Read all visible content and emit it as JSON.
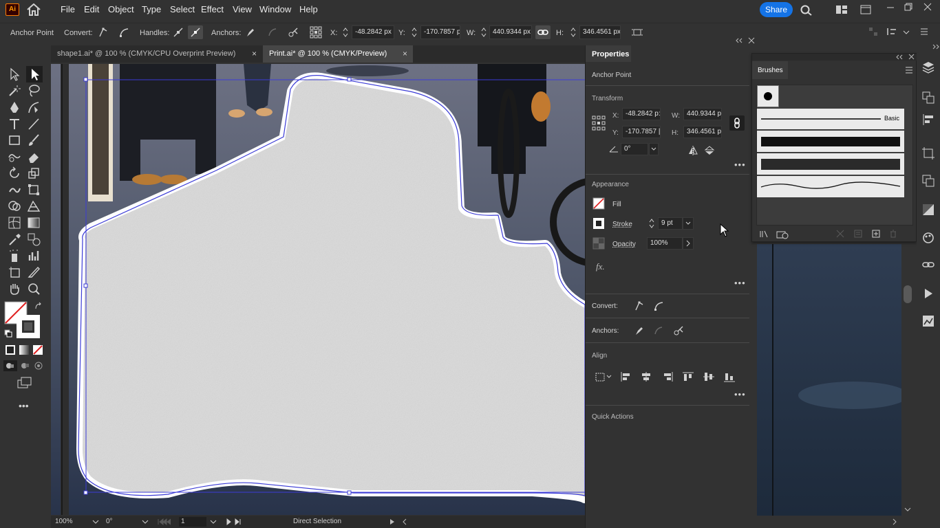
{
  "app": {
    "logo": "Ai",
    "share_label": "Share"
  },
  "menu": [
    "File",
    "Edit",
    "Object",
    "Type",
    "Select",
    "Effect",
    "View",
    "Window",
    "Help"
  ],
  "control": {
    "mode": "Anchor Point",
    "convert_label": "Convert:",
    "handles_label": "Handles:",
    "anchors_label": "Anchors:",
    "x_label": "X:",
    "x_value": "-48.2842 px",
    "y_label": "Y:",
    "y_value": "-170.7857 p",
    "w_label": "W:",
    "w_value": "440.9344 px",
    "h_label": "H:",
    "h_value": "346.4561 px"
  },
  "tabs": [
    {
      "label": "shape1.ai* @ 100 % (CMYK/CPU Overprint Preview)",
      "close": "×",
      "active": false
    },
    {
      "label": "Print.ai* @ 100 % (CMYK/Preview)",
      "close": "×",
      "active": true
    }
  ],
  "status": {
    "zoom": "100%",
    "rotation": "0°",
    "artboard": "1",
    "tool": "Direct Selection"
  },
  "properties": {
    "tab": "Properties",
    "context": "Anchor Point",
    "transform": {
      "title": "Transform",
      "x_label": "X:",
      "x_value": "-48.2842 p:",
      "y_label": "Y:",
      "y_value": "-170.7857 |",
      "w_label": "W:",
      "w_value": "440.9344 p",
      "h_label": "H:",
      "h_value": "346.4561 p",
      "angle": "0°"
    },
    "appearance": {
      "title": "Appearance",
      "fill": "Fill",
      "stroke": "Stroke",
      "stroke_value": "9 pt",
      "opacity": "Opacity",
      "opacity_value": "100%",
      "fx": "fx."
    },
    "convert": "Convert:",
    "anchors": "Anchors:",
    "align": "Align",
    "quick_actions": "Quick Actions"
  },
  "brushes": {
    "title": "Brushes",
    "basic": "Basic"
  },
  "colors": {
    "accent": "#1473e6",
    "path": "#3b3bd6",
    "panel": "#323232"
  }
}
